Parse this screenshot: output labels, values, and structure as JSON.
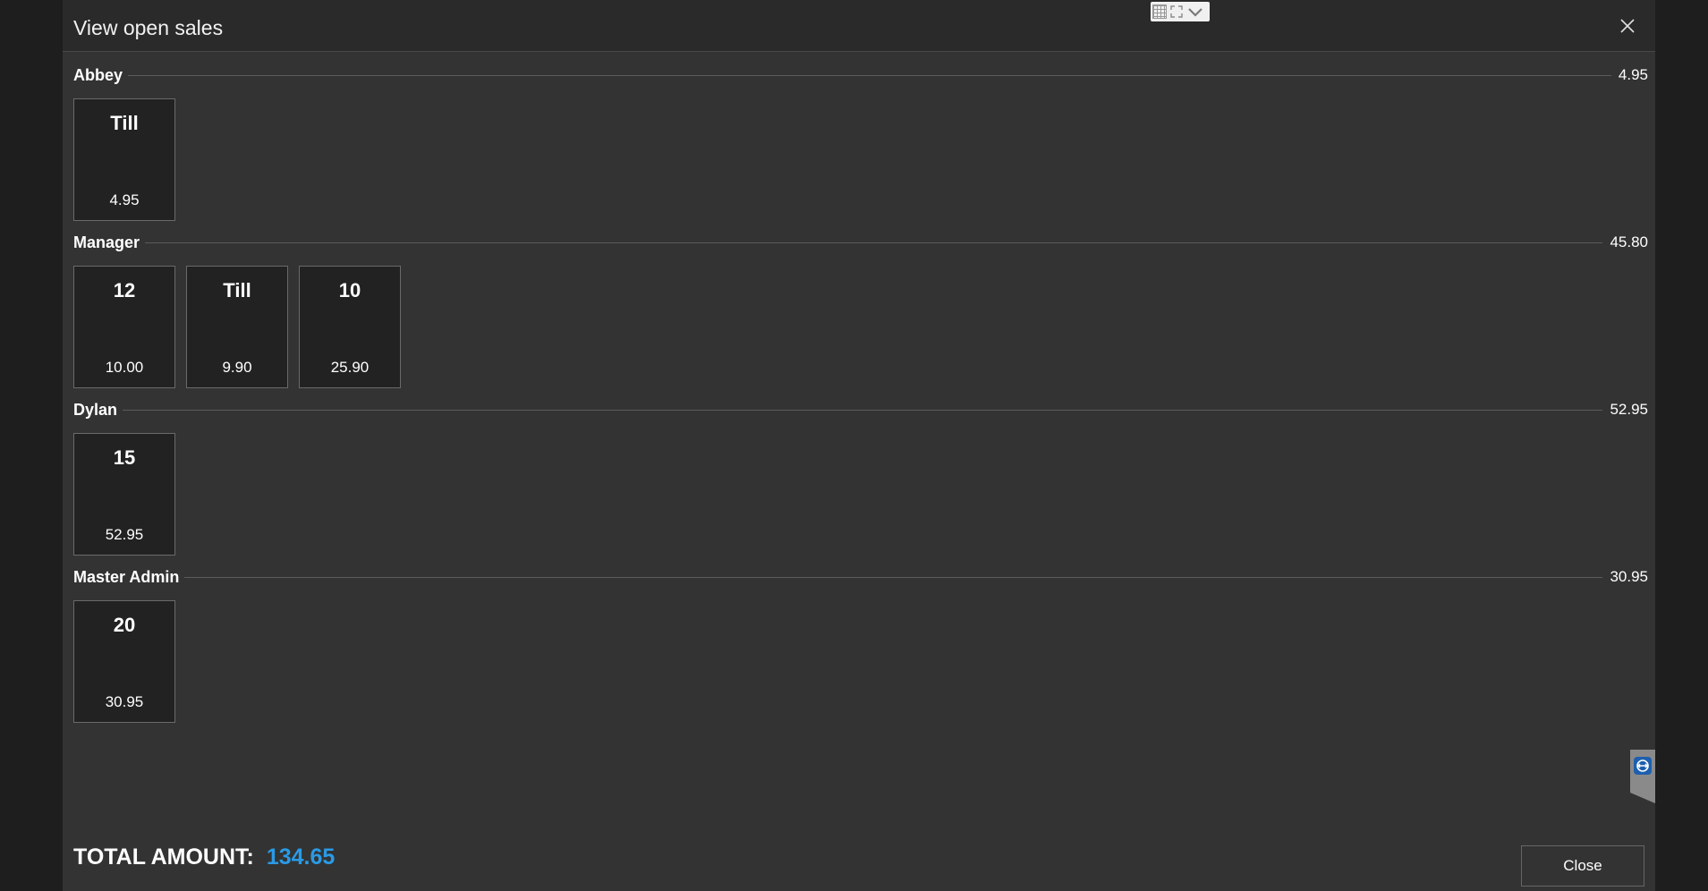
{
  "dialog": {
    "title": "View open sales",
    "close_button_label": "Close"
  },
  "groups": [
    {
      "name": "Abbey",
      "total": "4.95",
      "sales": [
        {
          "name": "Till",
          "amount": "4.95"
        }
      ]
    },
    {
      "name": "Manager",
      "total": "45.80",
      "sales": [
        {
          "name": "12",
          "amount": "10.00"
        },
        {
          "name": "Till",
          "amount": "9.90"
        },
        {
          "name": "10",
          "amount": "25.90"
        }
      ]
    },
    {
      "name": "Dylan",
      "total": "52.95",
      "sales": [
        {
          "name": "15",
          "amount": "52.95"
        }
      ]
    },
    {
      "name": "Master Admin",
      "total": "30.95",
      "sales": [
        {
          "name": "20",
          "amount": "30.95"
        }
      ]
    }
  ],
  "footer": {
    "total_label": "TOTAL AMOUNT:",
    "total_value": "134.65"
  },
  "colors": {
    "accent": "#2a9ae6",
    "dialog_bg": "#333333",
    "tile_bg": "#222222"
  },
  "icons": {
    "close": "close-icon",
    "grid": "grid-icon",
    "expand": "expand-icon",
    "chevron": "chevron-down-icon",
    "remote": "remote-session-icon"
  }
}
